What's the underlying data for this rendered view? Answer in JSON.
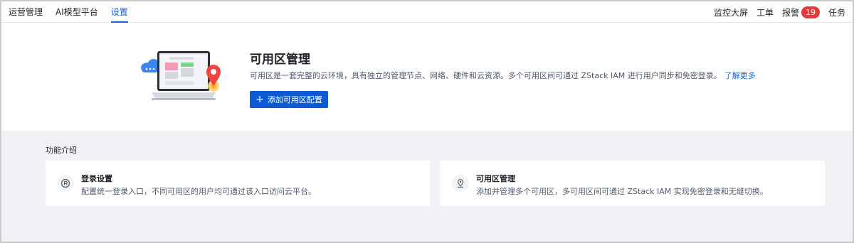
{
  "nav": {
    "tabs": [
      {
        "label": "运营管理"
      },
      {
        "label": "AI模型平台"
      },
      {
        "label": "设置"
      }
    ],
    "right": {
      "monitor": "监控大屏",
      "ticket": "工单",
      "alarm": "报警",
      "alarm_count": "19",
      "task": "任务"
    }
  },
  "hero": {
    "title": "可用区管理",
    "description": "可用区是一套完整的云环境，具有独立的管理节点、网络、硬件和云资源。多个可用区间可通过 ZStack IAM 进行用户同步和免密登录。",
    "learn_more": "了解更多",
    "add_button": "添加可用区配置",
    "add_icon": "+"
  },
  "features": {
    "title": "功能介绍",
    "cards": [
      {
        "title": "登录设置",
        "description": "配置统一登录入口，不同可用区的用户均可通过该入口访问云平台。",
        "icon": "login-setting-icon"
      },
      {
        "title": "可用区管理",
        "description": "添加并管理多个可用区，多可用区间可通过 ZStack IAM 实现免密登录和无缝切换。",
        "icon": "zone-location-icon"
      }
    ]
  },
  "colors": {
    "primary": "#0d5bd3",
    "link": "#1664d9",
    "badge": "#e8373a",
    "section_bg": "#f0f2f5"
  }
}
